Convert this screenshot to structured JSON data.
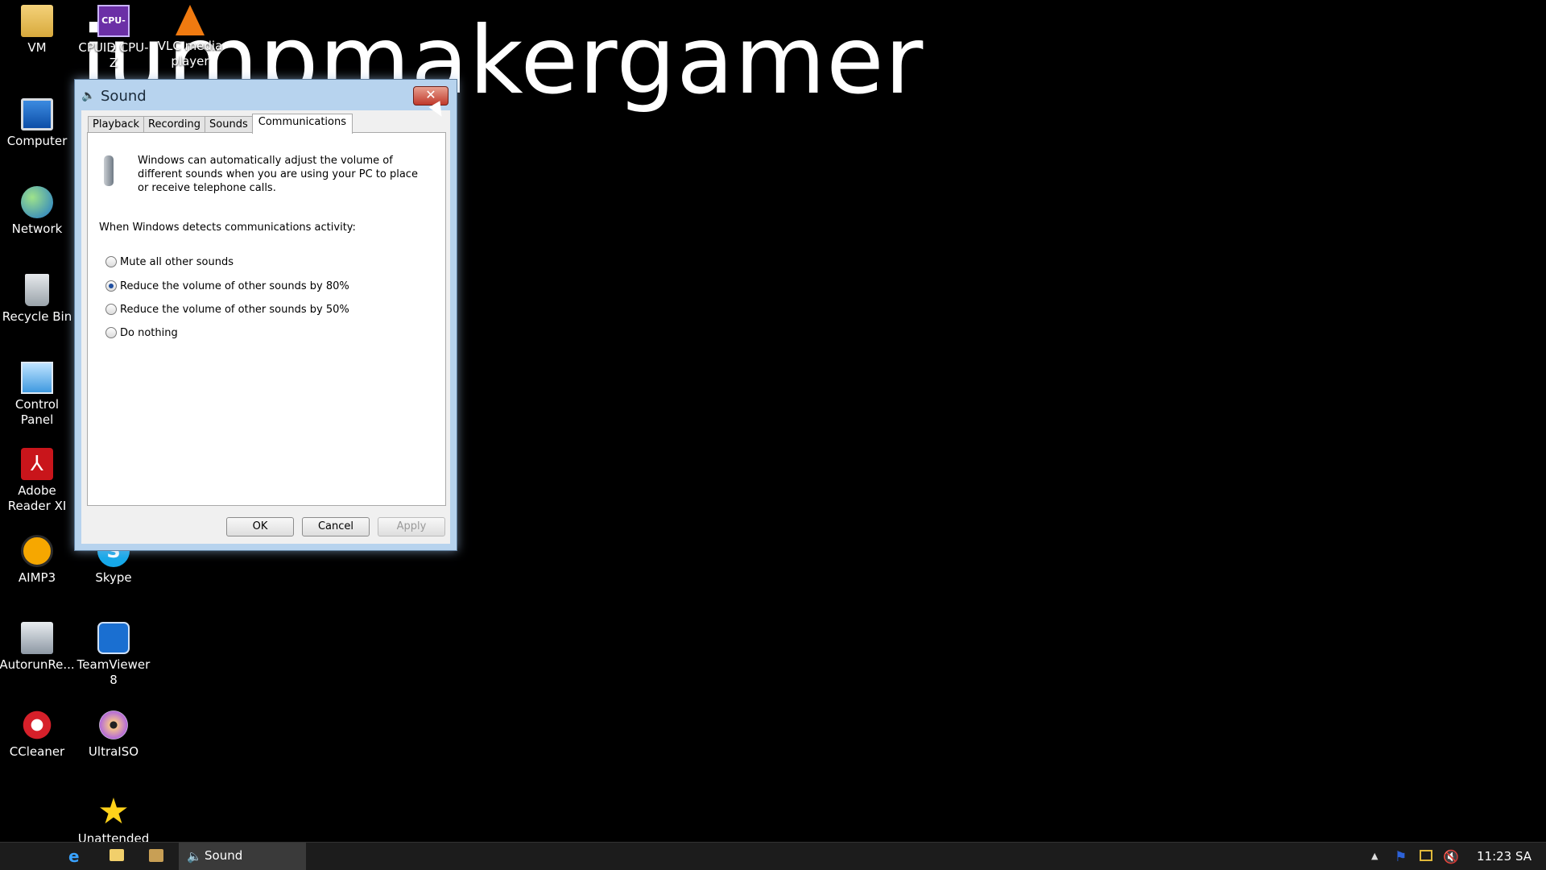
{
  "wallpaper": {
    "text": "jumpmakergamer"
  },
  "desktop_icons": [
    {
      "label": "VM",
      "icon": "folder-icon"
    },
    {
      "label": "CPUID CPU-Z",
      "icon": "cpuz-icon",
      "glyph": "CPU-Z"
    },
    {
      "label": "VLC media player",
      "icon": "vlc-icon"
    },
    {
      "label": "Computer",
      "icon": "computer-icon"
    },
    {
      "label": "Network",
      "icon": "network-icon"
    },
    {
      "label": "Recycle Bin",
      "icon": "recycle-bin-icon"
    },
    {
      "label": "Control Panel",
      "icon": "control-panel-icon"
    },
    {
      "label": "Adobe Reader XI",
      "icon": "adobe-reader-icon"
    },
    {
      "label": "AIMP3",
      "icon": "aimp-icon"
    },
    {
      "label": "Skype",
      "icon": "skype-icon"
    },
    {
      "label": "AutorunRe...",
      "icon": "autorun-icon"
    },
    {
      "label": "TeamViewer 8",
      "icon": "teamviewer-icon"
    },
    {
      "label": "CCleaner",
      "icon": "ccleaner-icon"
    },
    {
      "label": "UltraISO",
      "icon": "ultraiso-icon"
    },
    {
      "label": "Unattended",
      "icon": "star-icon"
    }
  ],
  "dialog": {
    "title": "Sound",
    "tabs": [
      {
        "label": "Playback",
        "active": false
      },
      {
        "label": "Recording",
        "active": false
      },
      {
        "label": "Sounds",
        "active": false
      },
      {
        "label": "Communications",
        "active": true
      }
    ],
    "description": "Windows can automatically adjust the volume of different sounds when you are using your PC to place or receive telephone calls.",
    "activity_label": "When Windows detects communications activity:",
    "options": [
      {
        "label": "Mute all other sounds",
        "selected": false
      },
      {
        "label": "Reduce the volume of other sounds by 80%",
        "selected": true
      },
      {
        "label": "Reduce the volume of other sounds by 50%",
        "selected": false
      },
      {
        "label": "Do nothing",
        "selected": false
      }
    ],
    "buttons": {
      "ok": "OK",
      "cancel": "Cancel",
      "apply": "Apply"
    }
  },
  "taskbar": {
    "active_task": "Sound",
    "clock": "11:23 SA"
  }
}
